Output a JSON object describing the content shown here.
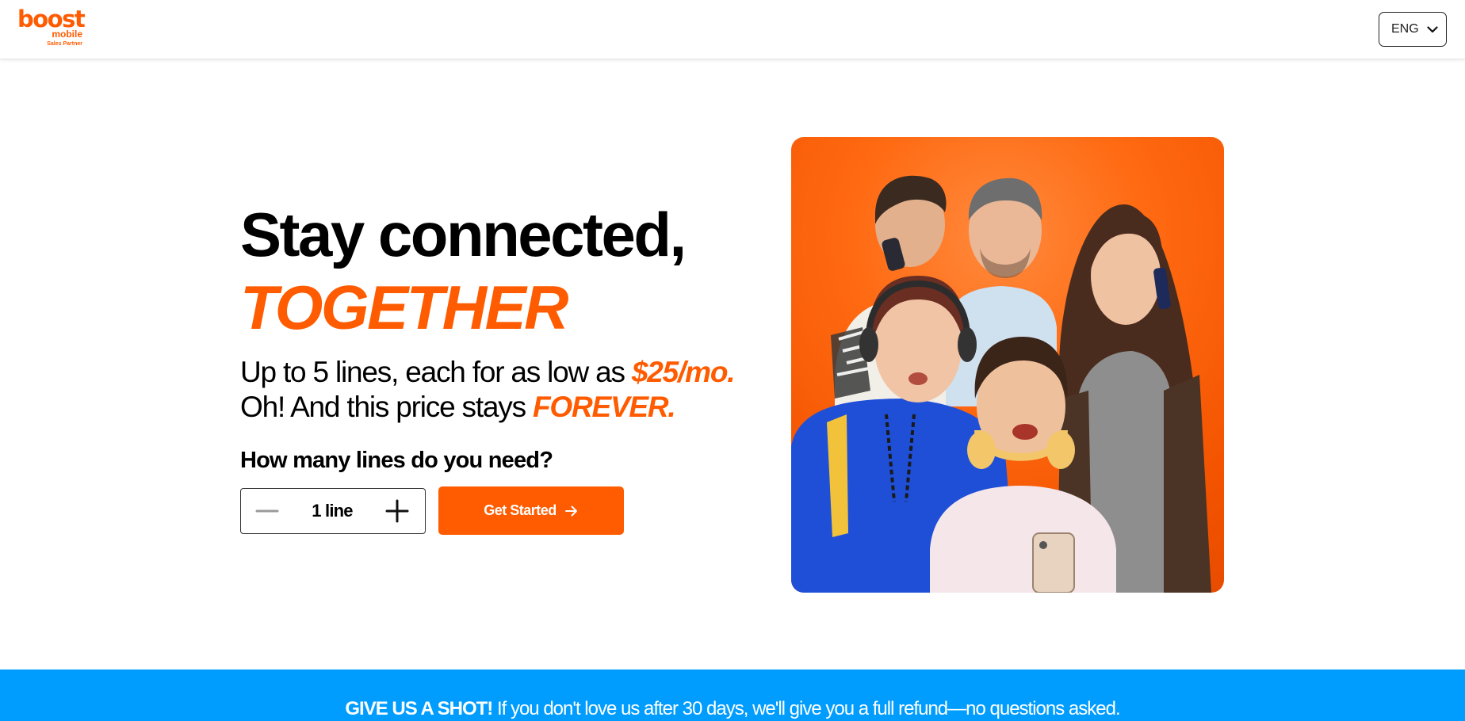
{
  "header": {
    "logo": {
      "wordmark": "boost",
      "sub": "mobile",
      "partner": "Sales Partner"
    },
    "language": {
      "selected": "ENG",
      "icon": "chevron-down-icon"
    }
  },
  "hero": {
    "headline": "Stay connected,",
    "headline_accent": "TOGETHER",
    "subline_1_text": "Up to 5 lines, each for as low as ",
    "subline_1_accent": "$25/mo.",
    "subline_2_text": "Oh! And this price stays ",
    "subline_2_accent": "FOREVER.",
    "question": "How many lines do you need?",
    "stepper": {
      "value": "1 line",
      "decrement_icon": "minus-icon",
      "increment_icon": "plus-icon"
    },
    "cta": {
      "label": "Get Started",
      "icon": "arrow-right-icon"
    },
    "image": {
      "subject": "family-group-photo"
    }
  },
  "banner": {
    "lead": "GIVE US A SHOT!",
    "text": " If you don't love us after 30 days, we'll give you a full refund—no questions asked."
  },
  "colors": {
    "brand_orange": "#ff5b00",
    "banner_blue": "#009dff",
    "text": "#000000",
    "white": "#ffffff"
  }
}
